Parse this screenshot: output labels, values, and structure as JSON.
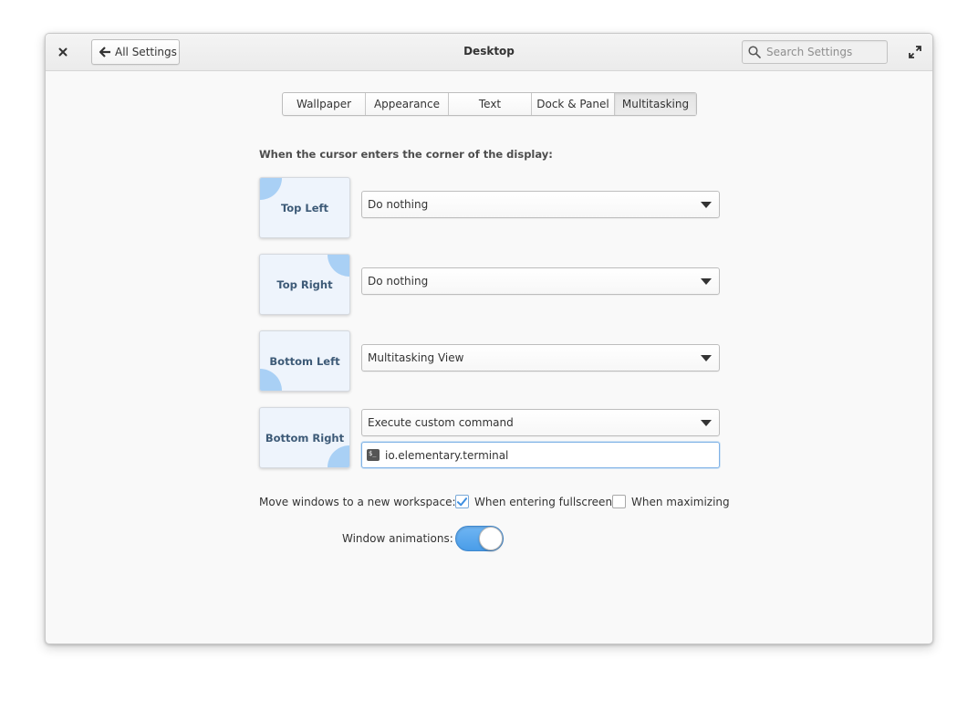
{
  "window": {
    "title": "Desktop",
    "back_label": "All Settings",
    "search_placeholder": "Search Settings"
  },
  "tabs": [
    {
      "label": "Wallpaper",
      "active": false
    },
    {
      "label": "Appearance",
      "active": false
    },
    {
      "label": "Text",
      "active": false
    },
    {
      "label": "Dock & Panel",
      "active": false
    },
    {
      "label": "Multitasking",
      "active": true
    }
  ],
  "hot_corners": {
    "heading": "When the cursor enters the corner of the display:",
    "corners": [
      {
        "label": "Top Left",
        "action": "Do nothing"
      },
      {
        "label": "Top Right",
        "action": "Do nothing"
      },
      {
        "label": "Bottom Left",
        "action": "Multitasking View"
      },
      {
        "label": "Bottom Right",
        "action": "Execute custom command"
      }
    ],
    "custom_command": "io.elementary.terminal"
  },
  "workspace": {
    "label": "Move windows to a new workspace:",
    "options": [
      {
        "label": "When entering fullscreen",
        "checked": true
      },
      {
        "label": "When maximizing",
        "checked": false
      }
    ]
  },
  "animations": {
    "label": "Window animations:",
    "enabled": true
  },
  "colors": {
    "accent": "#4a9de8",
    "corner_highlight": "#a9d0f5",
    "tile_background": "#eef4fc"
  },
  "icons": {
    "close": "close-icon",
    "back": "arrow-left-icon",
    "search": "search-icon",
    "maximize": "maximize-icon",
    "terminal": "terminal-icon",
    "check": "checkmark-icon",
    "dropdown": "chevron-down-icon"
  }
}
